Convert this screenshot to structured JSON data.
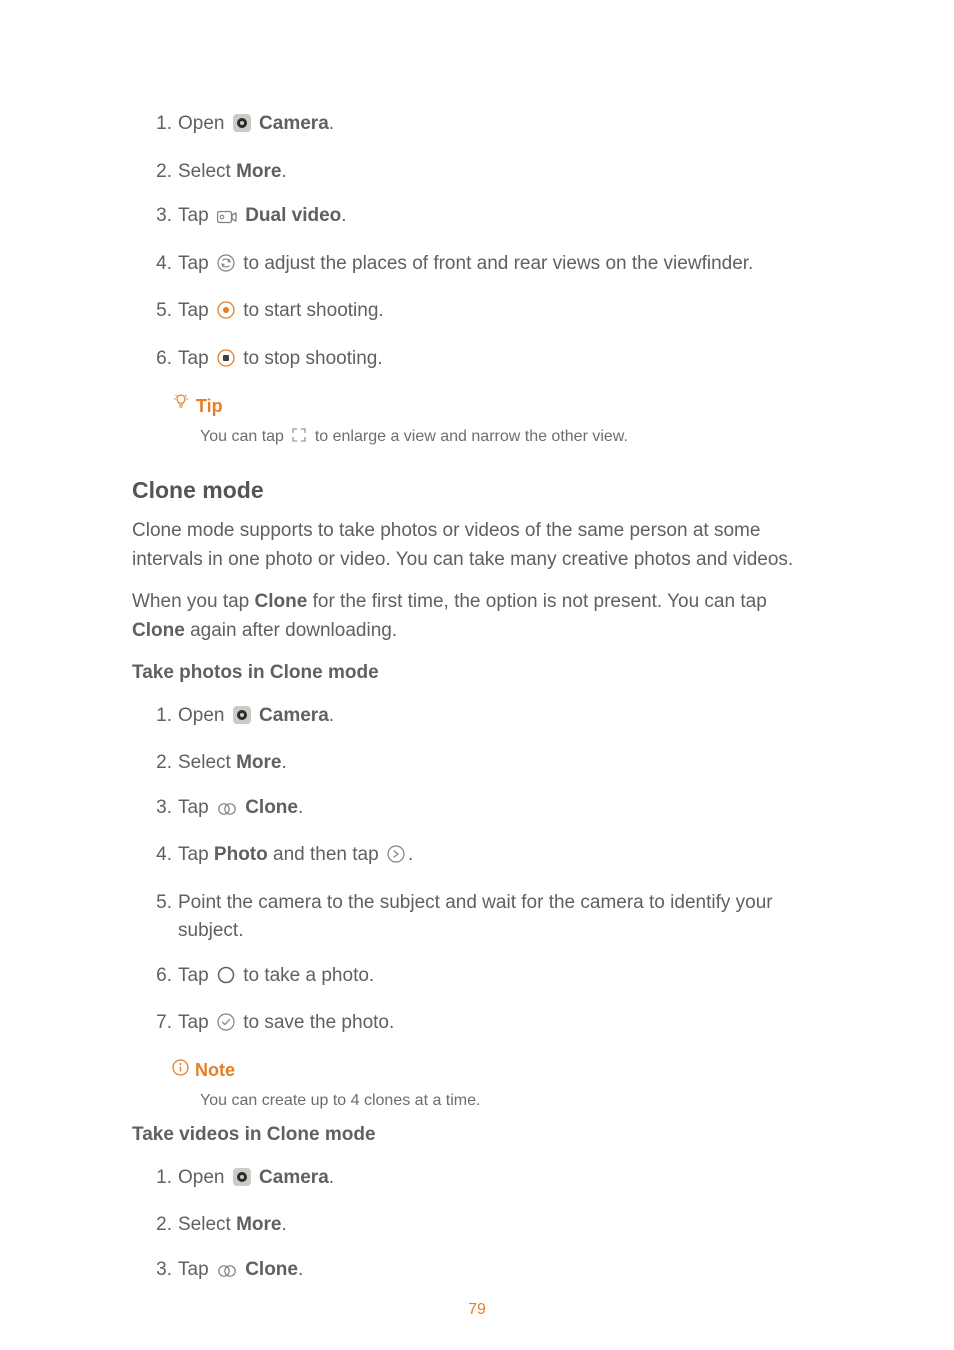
{
  "dualVideoSteps": {
    "s1_open": "Open",
    "s1_camera": "Camera",
    "s2_select": "Select",
    "s2_more": "More",
    "s3_tap": "Tap",
    "s3_dual": "Dual video",
    "s4_a": "Tap",
    "s4_b": "to adjust the places of front and rear views on the viewfinder.",
    "s5_a": "Tap",
    "s5_b": "to start shooting.",
    "s6_a": "Tap",
    "s6_b": "to stop shooting."
  },
  "tip": {
    "label": "Tip",
    "body_a": "You can tap",
    "body_b": "to enlarge a view and narrow the other view."
  },
  "clone": {
    "heading": "Clone mode",
    "para1": "Clone mode supports to take photos or videos of the same person at some intervals in one photo or video. You can take many creative photos and videos.",
    "para2_a": "When you tap",
    "para2_clone": "Clone",
    "para2_b": "for the first time, the option is not present. You can tap",
    "para2_c": "again after downloading."
  },
  "photosHeading": "Take photos in Clone mode",
  "photosSteps": {
    "s1_open": "Open",
    "s1_camera": "Camera",
    "s2_select": "Select",
    "s2_more": "More",
    "s3_tap": "Tap",
    "s3_clone": "Clone",
    "s4_a": "Tap",
    "s4_photo": "Photo",
    "s4_b": "and then tap",
    "s5": "Point the camera to the subject and wait for the camera to identify your subject.",
    "s6_a": "Tap",
    "s6_b": "to take a photo.",
    "s7_a": "Tap",
    "s7_b": "to save the photo."
  },
  "note": {
    "label": "Note",
    "body": "You can create up to 4 clones at a time."
  },
  "videosHeading": "Take videos in Clone mode",
  "videosSteps": {
    "s1_open": "Open",
    "s1_camera": "Camera",
    "s2_select": "Select",
    "s2_more": "More",
    "s3_tap": "Tap",
    "s3_clone": "Clone"
  },
  "pageNumber": "79"
}
